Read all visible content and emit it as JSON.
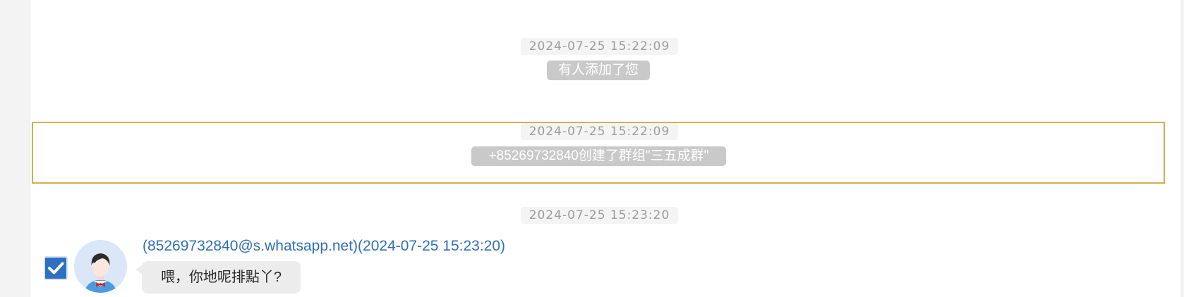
{
  "messages": [
    {
      "timestamp": "2024-07-25 15:22:09",
      "system_text": "有人添加了您"
    },
    {
      "timestamp": "2024-07-25 15:22:09",
      "system_text": "+85269732840创建了群组\"三五成群\"",
      "highlighted": true
    },
    {
      "timestamp": "2024-07-25 15:23:20",
      "sender": "(85269732840@s.whatsapp.net)(2024-07-25 15:23:20)",
      "text": "喂，你地呢排點丫?",
      "checked": true
    }
  ],
  "colors": {
    "highlight_border": "#d8ac4e",
    "sender_link": "#2f6fb8",
    "checkbox": "#2f6fc2"
  },
  "icons": {
    "checkbox": "checkmark-icon",
    "avatar": "default-user-avatar-icon"
  }
}
